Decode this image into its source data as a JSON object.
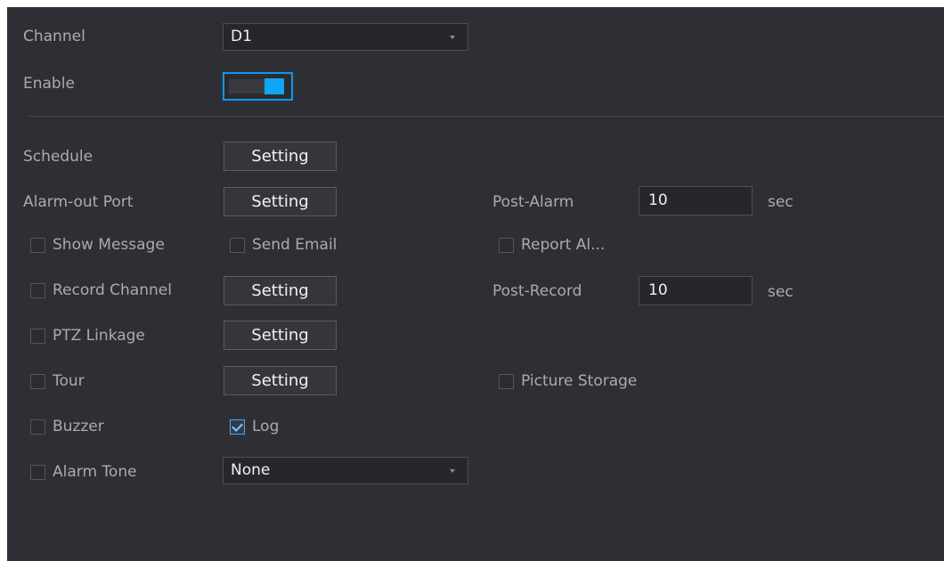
{
  "channel": {
    "label": "Channel",
    "value": "D1"
  },
  "enable": {
    "label": "Enable",
    "on": true
  },
  "schedule": {
    "label": "Schedule",
    "button": "Setting"
  },
  "alarm_out": {
    "label": "Alarm-out Port",
    "button": "Setting"
  },
  "post_alarm": {
    "label": "Post-Alarm",
    "value": "10",
    "unit": "sec"
  },
  "show_message": {
    "label": "Show Message",
    "checked": false
  },
  "send_email": {
    "label": "Send Email",
    "checked": false
  },
  "report_alarm": {
    "label": "Report Al...",
    "checked": false
  },
  "record_channel": {
    "label": "Record Channel",
    "checked": false,
    "button": "Setting"
  },
  "post_record": {
    "label": "Post-Record",
    "value": "10",
    "unit": "sec"
  },
  "ptz_linkage": {
    "label": "PTZ Linkage",
    "checked": false,
    "button": "Setting"
  },
  "tour": {
    "label": "Tour",
    "checked": false,
    "button": "Setting"
  },
  "picture_storage": {
    "label": "Picture Storage",
    "checked": false
  },
  "buzzer": {
    "label": "Buzzer",
    "checked": false
  },
  "log": {
    "label": "Log",
    "checked": true
  },
  "alarm_tone": {
    "label": "Alarm Tone",
    "checked": false,
    "value": "None"
  },
  "colors": {
    "background": "#2e2f35",
    "accent": "#0fa6f4",
    "text": "#a9abb2"
  }
}
